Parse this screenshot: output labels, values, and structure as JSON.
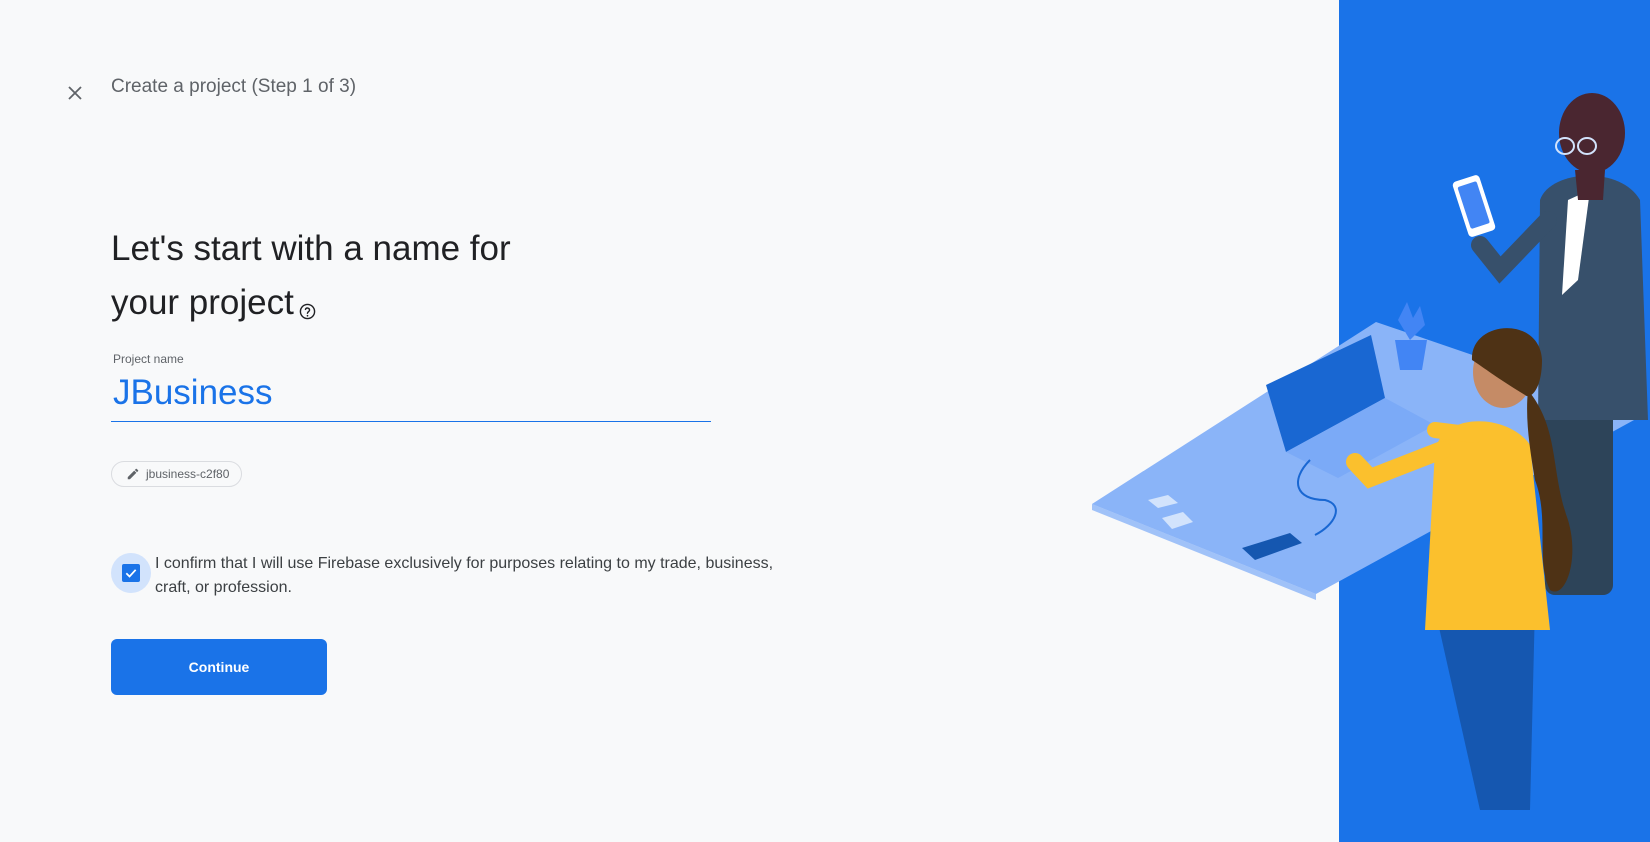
{
  "header": {
    "close_icon": "close-icon",
    "step_title": "Create a project (Step 1 of 3)"
  },
  "main": {
    "heading_line1": "Let's start with a name for",
    "heading_line2": "your project",
    "help_icon": "help-circle-icon",
    "project_name": {
      "label": "Project name",
      "value": "JBusiness"
    },
    "project_id": {
      "icon": "pencil-icon",
      "value": "jbusiness-c2f80"
    },
    "confirm": {
      "checked": true,
      "text": "I confirm that I will use Firebase exclusively for purposes relating to my trade, business, craft, or profession."
    },
    "continue_label": "Continue"
  },
  "colors": {
    "accent": "#1a73e8",
    "background": "#f8f9fa",
    "panel": "#1a73e8"
  }
}
